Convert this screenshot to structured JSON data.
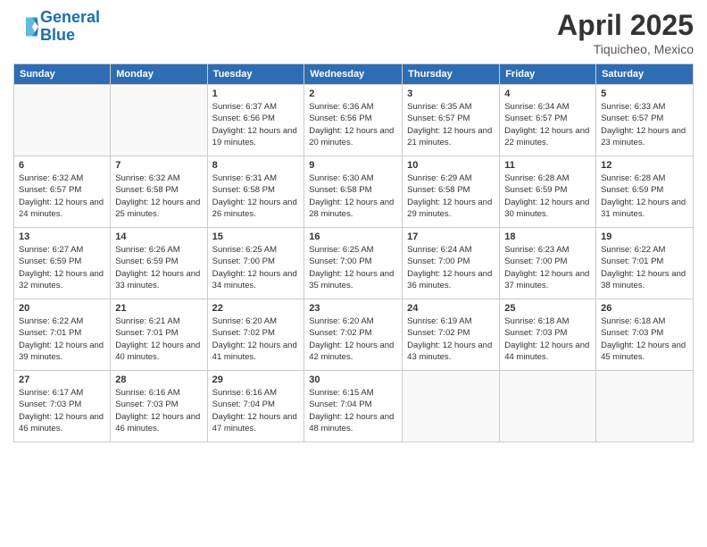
{
  "header": {
    "logo_line1": "General",
    "logo_line2": "Blue",
    "month_title": "April 2025",
    "subtitle": "Tiquicheo, Mexico"
  },
  "days": {
    "headers": [
      "Sunday",
      "Monday",
      "Tuesday",
      "Wednesday",
      "Thursday",
      "Friday",
      "Saturday"
    ]
  },
  "weeks": [
    [
      {
        "num": "",
        "info": ""
      },
      {
        "num": "",
        "info": ""
      },
      {
        "num": "1",
        "info": "Sunrise: 6:37 AM\nSunset: 6:56 PM\nDaylight: 12 hours and 19 minutes."
      },
      {
        "num": "2",
        "info": "Sunrise: 6:36 AM\nSunset: 6:56 PM\nDaylight: 12 hours and 20 minutes."
      },
      {
        "num": "3",
        "info": "Sunrise: 6:35 AM\nSunset: 6:57 PM\nDaylight: 12 hours and 21 minutes."
      },
      {
        "num": "4",
        "info": "Sunrise: 6:34 AM\nSunset: 6:57 PM\nDaylight: 12 hours and 22 minutes."
      },
      {
        "num": "5",
        "info": "Sunrise: 6:33 AM\nSunset: 6:57 PM\nDaylight: 12 hours and 23 minutes."
      }
    ],
    [
      {
        "num": "6",
        "info": "Sunrise: 6:32 AM\nSunset: 6:57 PM\nDaylight: 12 hours and 24 minutes."
      },
      {
        "num": "7",
        "info": "Sunrise: 6:32 AM\nSunset: 6:58 PM\nDaylight: 12 hours and 25 minutes."
      },
      {
        "num": "8",
        "info": "Sunrise: 6:31 AM\nSunset: 6:58 PM\nDaylight: 12 hours and 26 minutes."
      },
      {
        "num": "9",
        "info": "Sunrise: 6:30 AM\nSunset: 6:58 PM\nDaylight: 12 hours and 28 minutes."
      },
      {
        "num": "10",
        "info": "Sunrise: 6:29 AM\nSunset: 6:58 PM\nDaylight: 12 hours and 29 minutes."
      },
      {
        "num": "11",
        "info": "Sunrise: 6:28 AM\nSunset: 6:59 PM\nDaylight: 12 hours and 30 minutes."
      },
      {
        "num": "12",
        "info": "Sunrise: 6:28 AM\nSunset: 6:59 PM\nDaylight: 12 hours and 31 minutes."
      }
    ],
    [
      {
        "num": "13",
        "info": "Sunrise: 6:27 AM\nSunset: 6:59 PM\nDaylight: 12 hours and 32 minutes."
      },
      {
        "num": "14",
        "info": "Sunrise: 6:26 AM\nSunset: 6:59 PM\nDaylight: 12 hours and 33 minutes."
      },
      {
        "num": "15",
        "info": "Sunrise: 6:25 AM\nSunset: 7:00 PM\nDaylight: 12 hours and 34 minutes."
      },
      {
        "num": "16",
        "info": "Sunrise: 6:25 AM\nSunset: 7:00 PM\nDaylight: 12 hours and 35 minutes."
      },
      {
        "num": "17",
        "info": "Sunrise: 6:24 AM\nSunset: 7:00 PM\nDaylight: 12 hours and 36 minutes."
      },
      {
        "num": "18",
        "info": "Sunrise: 6:23 AM\nSunset: 7:00 PM\nDaylight: 12 hours and 37 minutes."
      },
      {
        "num": "19",
        "info": "Sunrise: 6:22 AM\nSunset: 7:01 PM\nDaylight: 12 hours and 38 minutes."
      }
    ],
    [
      {
        "num": "20",
        "info": "Sunrise: 6:22 AM\nSunset: 7:01 PM\nDaylight: 12 hours and 39 minutes."
      },
      {
        "num": "21",
        "info": "Sunrise: 6:21 AM\nSunset: 7:01 PM\nDaylight: 12 hours and 40 minutes."
      },
      {
        "num": "22",
        "info": "Sunrise: 6:20 AM\nSunset: 7:02 PM\nDaylight: 12 hours and 41 minutes."
      },
      {
        "num": "23",
        "info": "Sunrise: 6:20 AM\nSunset: 7:02 PM\nDaylight: 12 hours and 42 minutes."
      },
      {
        "num": "24",
        "info": "Sunrise: 6:19 AM\nSunset: 7:02 PM\nDaylight: 12 hours and 43 minutes."
      },
      {
        "num": "25",
        "info": "Sunrise: 6:18 AM\nSunset: 7:03 PM\nDaylight: 12 hours and 44 minutes."
      },
      {
        "num": "26",
        "info": "Sunrise: 6:18 AM\nSunset: 7:03 PM\nDaylight: 12 hours and 45 minutes."
      }
    ],
    [
      {
        "num": "27",
        "info": "Sunrise: 6:17 AM\nSunset: 7:03 PM\nDaylight: 12 hours and 46 minutes."
      },
      {
        "num": "28",
        "info": "Sunrise: 6:16 AM\nSunset: 7:03 PM\nDaylight: 12 hours and 46 minutes."
      },
      {
        "num": "29",
        "info": "Sunrise: 6:16 AM\nSunset: 7:04 PM\nDaylight: 12 hours and 47 minutes."
      },
      {
        "num": "30",
        "info": "Sunrise: 6:15 AM\nSunset: 7:04 PM\nDaylight: 12 hours and 48 minutes."
      },
      {
        "num": "",
        "info": ""
      },
      {
        "num": "",
        "info": ""
      },
      {
        "num": "",
        "info": ""
      }
    ]
  ]
}
